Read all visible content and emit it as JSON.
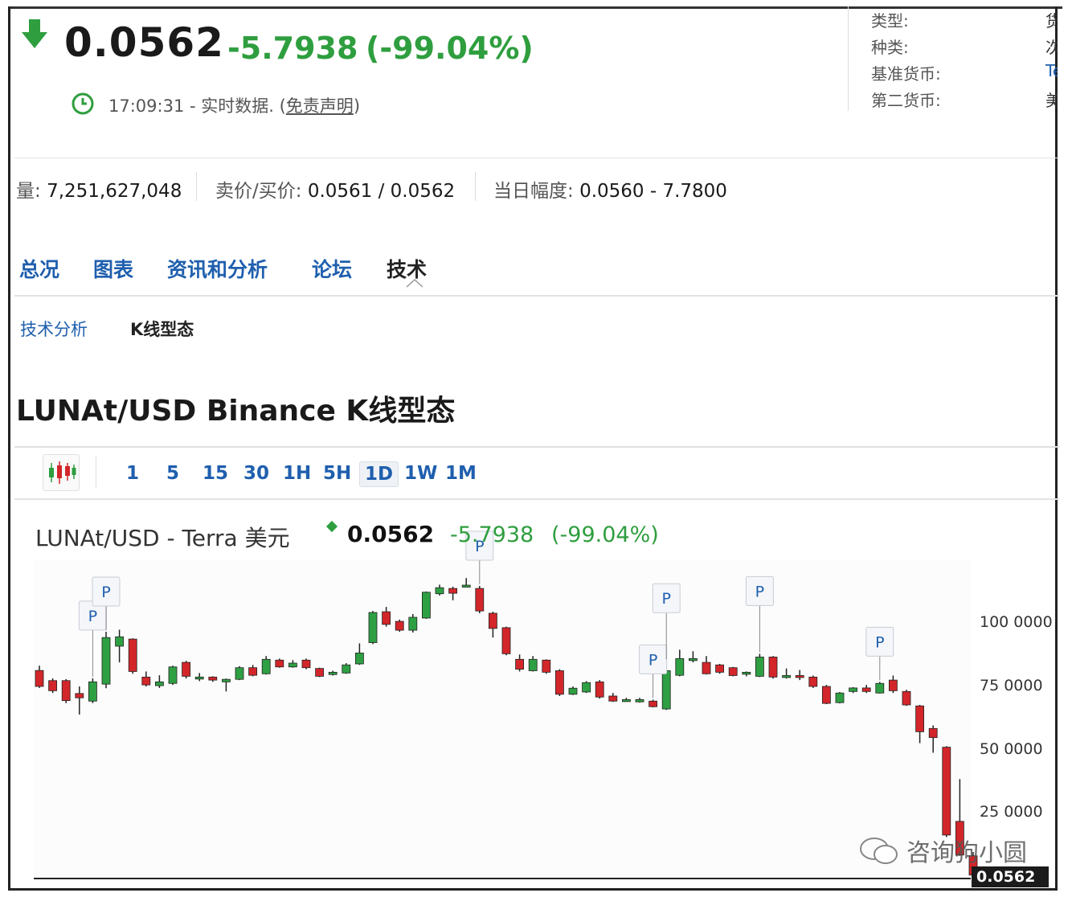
{
  "header": {
    "price": "0.0562",
    "change": "-5.7938",
    "change_pct": "(-99.04%)",
    "time": "17:09:31",
    "realtime_text": " - 实时数据. (",
    "disclaimer": "免责声明",
    "close_paren": ")",
    "down_color": "#2e9e3e"
  },
  "right_info": {
    "rows": [
      {
        "label": "类型:",
        "value": "货"
      },
      {
        "label": "种类:",
        "value": "次"
      },
      {
        "label": "基准货币:",
        "value": "Te"
      },
      {
        "label": "第二货币:",
        "value": "美"
      }
    ]
  },
  "stats": {
    "volume_label": "量:",
    "volume": "7,251,627,048",
    "bidask_label": "卖价/买价:",
    "bidask": "0.0561 / 0.0562",
    "range_label": "当日幅度:",
    "range": "0.0560 - 7.7800"
  },
  "tabs": [
    "总况",
    "图表",
    "资讯和分析",
    "论坛",
    "技术"
  ],
  "subtabs": [
    "技术分析",
    "K线型态"
  ],
  "page_title": "LUNAt/USD Binance K线型态",
  "intervals": [
    "1",
    "5",
    "15",
    "30",
    "1H",
    "5H",
    "1D",
    "1W",
    "1M"
  ],
  "active_interval": "1D",
  "legend": {
    "name": "LUNAt/USD - Terra 美元",
    "price": "0.0562",
    "change": "-5.7938",
    "change_pct": "(-99.04%)"
  },
  "pattern_marker_label": "P",
  "watermark": "咨询狗小圆",
  "chart_data": {
    "type": "candlestick",
    "y_ticks": [
      "100 0000",
      "75 0000",
      "50 0000",
      "25 0000"
    ],
    "last_price_label": "0.0562",
    "up_color": "#2ea043",
    "down_color": "#d3262a",
    "candles": [
      {
        "o": 80.9,
        "c": 74.6,
        "h": 82.8,
        "l": 74.0
      },
      {
        "o": 76.9,
        "c": 72.9,
        "h": 77.8,
        "l": 72.0
      },
      {
        "o": 76.9,
        "c": 69.0,
        "h": 77.5,
        "l": 68.0
      },
      {
        "o": 71.8,
        "c": 70.1,
        "h": 74.6,
        "l": 63.5
      },
      {
        "o": 68.8,
        "c": 76.4,
        "h": 77.8,
        "l": 68.0
      },
      {
        "o": 75.5,
        "c": 93.9,
        "h": 96.2,
        "l": 73.9
      },
      {
        "o": 90.5,
        "c": 94.2,
        "h": 97.0,
        "l": 84.1
      },
      {
        "o": 93.3,
        "c": 80.5,
        "h": 93.6,
        "l": 79.6
      },
      {
        "o": 78.3,
        "c": 75.2,
        "h": 80.5,
        "l": 74.6
      },
      {
        "o": 74.9,
        "c": 76.4,
        "h": 79.0,
        "l": 74.0
      },
      {
        "o": 75.8,
        "c": 82.3,
        "h": 82.8,
        "l": 75.2
      },
      {
        "o": 84.1,
        "c": 78.6,
        "h": 84.7,
        "l": 77.7
      },
      {
        "o": 78.0,
        "c": 78.3,
        "h": 79.9,
        "l": 76.7
      },
      {
        "o": 78.3,
        "c": 77.1,
        "h": 78.6,
        "l": 76.4
      },
      {
        "o": 76.4,
        "c": 77.4,
        "h": 77.7,
        "l": 72.6
      },
      {
        "o": 77.4,
        "c": 82.0,
        "h": 82.6,
        "l": 77.1
      },
      {
        "o": 82.0,
        "c": 79.0,
        "h": 83.1,
        "l": 78.6
      },
      {
        "o": 79.6,
        "c": 85.3,
        "h": 86.6,
        "l": 79.3
      },
      {
        "o": 85.0,
        "c": 82.3,
        "h": 85.6,
        "l": 82.0
      },
      {
        "o": 82.3,
        "c": 83.8,
        "h": 85.0,
        "l": 82.0
      },
      {
        "o": 85.0,
        "c": 82.0,
        "h": 85.6,
        "l": 81.4
      },
      {
        "o": 81.7,
        "c": 78.6,
        "h": 82.0,
        "l": 78.3
      },
      {
        "o": 79.3,
        "c": 80.2,
        "h": 80.8,
        "l": 78.9
      },
      {
        "o": 79.9,
        "c": 83.1,
        "h": 83.8,
        "l": 79.6
      },
      {
        "o": 83.5,
        "c": 87.8,
        "h": 91.6,
        "l": 83.1
      },
      {
        "o": 91.9,
        "c": 103.8,
        "h": 104.4,
        "l": 91.3
      },
      {
        "o": 104.1,
        "c": 99.1,
        "h": 106.0,
        "l": 98.2
      },
      {
        "o": 100.3,
        "c": 96.8,
        "h": 101.0,
        "l": 96.2
      },
      {
        "o": 96.8,
        "c": 101.9,
        "h": 103.2,
        "l": 95.9
      },
      {
        "o": 101.6,
        "c": 111.8,
        "h": 112.1,
        "l": 101.3
      },
      {
        "o": 111.2,
        "c": 113.6,
        "h": 114.8,
        "l": 110.5
      },
      {
        "o": 113.3,
        "c": 111.4,
        "h": 114.0,
        "l": 108.6
      },
      {
        "o": 114.3,
        "c": 114.6,
        "h": 117.4,
        "l": 113.9
      },
      {
        "o": 113.3,
        "c": 104.4,
        "h": 114.3,
        "l": 103.5
      },
      {
        "o": 103.5,
        "c": 97.5,
        "h": 104.1,
        "l": 93.9
      },
      {
        "o": 97.8,
        "c": 87.5,
        "h": 98.2,
        "l": 86.9
      },
      {
        "o": 85.3,
        "c": 81.4,
        "h": 87.2,
        "l": 80.5
      },
      {
        "o": 80.8,
        "c": 85.3,
        "h": 86.6,
        "l": 80.5
      },
      {
        "o": 85.0,
        "c": 80.2,
        "h": 85.3,
        "l": 79.6
      },
      {
        "o": 80.8,
        "c": 71.5,
        "h": 81.4,
        "l": 70.8
      },
      {
        "o": 71.5,
        "c": 73.9,
        "h": 74.6,
        "l": 71.2
      },
      {
        "o": 72.4,
        "c": 76.1,
        "h": 76.7,
        "l": 72.0
      },
      {
        "o": 76.4,
        "c": 70.4,
        "h": 77.1,
        "l": 69.8
      },
      {
        "o": 70.8,
        "c": 68.8,
        "h": 72.0,
        "l": 68.5
      },
      {
        "o": 69.4,
        "c": 69.4,
        "h": 70.1,
        "l": 68.5
      },
      {
        "o": 68.5,
        "c": 69.4,
        "h": 70.1,
        "l": 68.2
      },
      {
        "o": 68.8,
        "c": 66.6,
        "h": 69.4,
        "l": 66.3
      },
      {
        "o": 65.7,
        "c": 80.8,
        "h": 84.7,
        "l": 65.3
      },
      {
        "o": 79.0,
        "c": 85.6,
        "h": 89.1,
        "l": 78.6
      },
      {
        "o": 85.3,
        "c": 85.6,
        "h": 88.5,
        "l": 84.1
      },
      {
        "o": 84.1,
        "c": 79.6,
        "h": 86.6,
        "l": 79.3
      },
      {
        "o": 83.1,
        "c": 80.2,
        "h": 83.5,
        "l": 79.6
      },
      {
        "o": 82.0,
        "c": 78.9,
        "h": 82.3,
        "l": 78.6
      },
      {
        "o": 79.9,
        "c": 80.2,
        "h": 80.5,
        "l": 78.6
      },
      {
        "o": 78.6,
        "c": 86.2,
        "h": 87.5,
        "l": 78.3
      },
      {
        "o": 86.2,
        "c": 78.3,
        "h": 86.6,
        "l": 77.7
      },
      {
        "o": 78.6,
        "c": 78.9,
        "h": 81.7,
        "l": 77.7
      },
      {
        "o": 78.9,
        "c": 78.6,
        "h": 81.1,
        "l": 77.1
      },
      {
        "o": 78.3,
        "c": 74.6,
        "h": 78.9,
        "l": 74.0
      },
      {
        "o": 74.6,
        "c": 67.9,
        "h": 75.2,
        "l": 67.6
      },
      {
        "o": 68.2,
        "c": 72.0,
        "h": 72.4,
        "l": 67.9
      },
      {
        "o": 72.6,
        "c": 74.0,
        "h": 74.3,
        "l": 72.0
      },
      {
        "o": 74.0,
        "c": 72.6,
        "h": 75.2,
        "l": 72.0
      },
      {
        "o": 72.0,
        "c": 75.8,
        "h": 76.4,
        "l": 71.8
      },
      {
        "o": 77.1,
        "c": 72.9,
        "h": 78.9,
        "l": 72.0
      },
      {
        "o": 72.6,
        "c": 67.3,
        "h": 73.3,
        "l": 66.9
      },
      {
        "o": 66.9,
        "c": 56.7,
        "h": 67.3,
        "l": 52.2
      },
      {
        "o": 58.0,
        "c": 54.4,
        "h": 59.2,
        "l": 48.4
      },
      {
        "o": 50.6,
        "c": 15.9,
        "h": 51.0,
        "l": 15.1
      },
      {
        "o": 21.3,
        "c": 8.0,
        "h": 38.0,
        "l": 7.7
      },
      {
        "o": 7.7,
        "c": 0.1,
        "h": 9.2,
        "l": 0.0
      }
    ],
    "pattern_markers": [
      {
        "candle": 4,
        "side": "above",
        "level": 2
      },
      {
        "candle": 5,
        "side": "above",
        "level": 1
      },
      {
        "candle": 33,
        "side": "above",
        "level": 1
      },
      {
        "candle": 46,
        "side": "above",
        "level": 1
      },
      {
        "candle": 47,
        "side": "above",
        "level": 2
      },
      {
        "candle": 54,
        "side": "above",
        "level": 2
      },
      {
        "candle": 63,
        "side": "above",
        "level": 1
      }
    ]
  }
}
